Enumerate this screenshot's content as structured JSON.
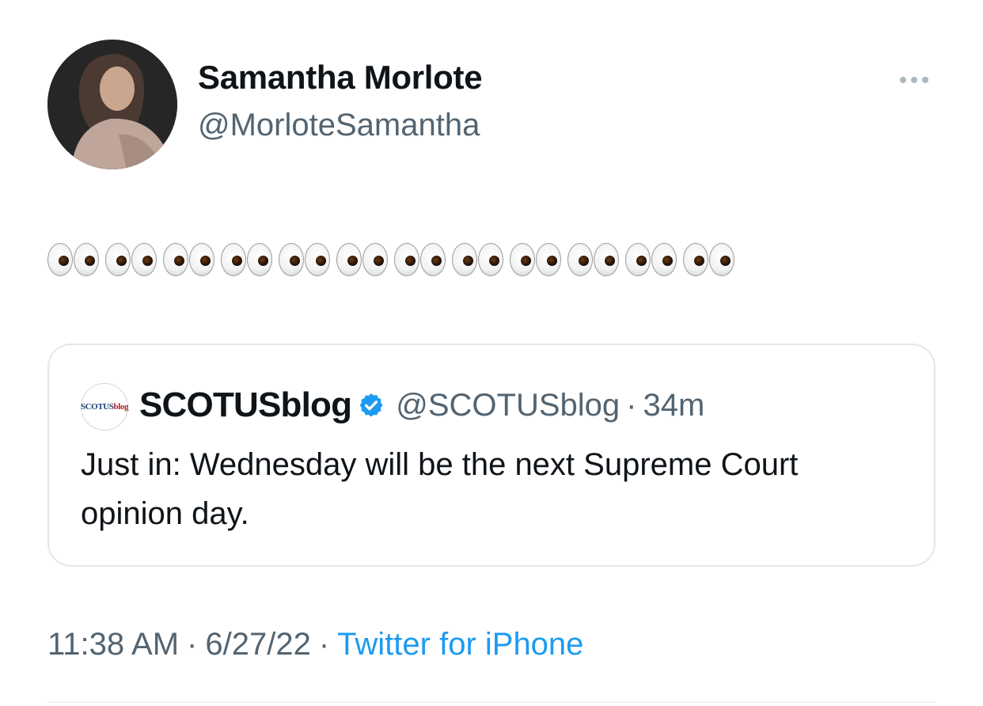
{
  "author": {
    "display_name": "Samantha Morlote",
    "handle": "@MorloteSamantha"
  },
  "more_icon": "more-horizontal-icon",
  "tweet": {
    "text_icons": [
      "eyes-emoji",
      "eyes-emoji",
      "eyes-emoji",
      "eyes-emoji",
      "eyes-emoji",
      "eyes-emoji",
      "eyes-emoji",
      "eyes-emoji",
      "eyes-emoji",
      "eyes-emoji",
      "eyes-emoji",
      "eyes-emoji"
    ]
  },
  "quoted_tweet": {
    "avatar_text_blue": "SCOTUS",
    "avatar_text_red": "blog",
    "display_name": "SCOTUSblog",
    "verified_icon": "verified-badge-icon",
    "handle": "@SCOTUSblog",
    "separator": "·",
    "time": "34m",
    "text": "Just in: Wednesday will be the next Supreme Court opinion day."
  },
  "meta": {
    "time": "11:38 AM",
    "date": "6/27/22",
    "separator": "·",
    "source": "Twitter for iPhone"
  },
  "colors": {
    "accent": "#1d9bf0",
    "secondary_text": "#536471",
    "border": "#e1e8ed"
  }
}
